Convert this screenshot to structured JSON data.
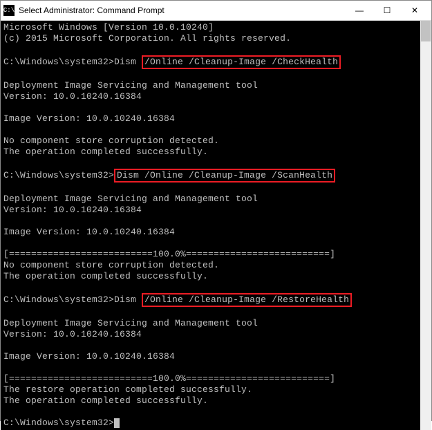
{
  "titlebar": {
    "icon_label": "C:\\",
    "title": "Select Administrator: Command Prompt",
    "minimize": "—",
    "maximize": "☐",
    "close": "✕"
  },
  "console": {
    "line1": "Microsoft Windows [Version 10.0.10240]",
    "line2": "(c) 2015 Microsoft Corporation. All rights reserved.",
    "prompt1_path": "C:\\Windows\\system32>",
    "cmd1_prefix": "Dism ",
    "cmd1_hl": "/Online /Cleanup-Image /CheckHealth",
    "tool_line1": "Deployment Image Servicing and Management tool",
    "ver_line1": "Version: 10.0.10240.16384",
    "imgver_line1": "Image Version: 10.0.10240.16384",
    "nocorrupt1": "No component store corruption detected.",
    "success1": "The operation completed successfully.",
    "prompt2_path": "C:\\Windows\\system32>",
    "cmd2_hl": "Dism /Online /Cleanup-Image /ScanHealth",
    "tool_line2": "Deployment Image Servicing and Management tool",
    "ver_line2": "Version: 10.0.10240.16384",
    "imgver_line2": "Image Version: 10.0.10240.16384",
    "progress1": "[==========================100.0%==========================]",
    "nocorrupt2": "No component store corruption detected.",
    "success2": "The operation completed successfully.",
    "prompt3_path": "C:\\Windows\\system32>",
    "cmd3_prefix": "Dism ",
    "cmd3_hl": "/Online /Cleanup-Image /RestoreHealth",
    "tool_line3": "Deployment Image Servicing and Management tool",
    "ver_line3": "Version: 10.0.10240.16384",
    "imgver_line3": "Image Version: 10.0.10240.16384",
    "progress2": "[==========================100.0%==========================]",
    "restore_success": "The restore operation completed successfully.",
    "success3": "The operation completed successfully.",
    "prompt4_path": "C:\\Windows\\system32>"
  }
}
